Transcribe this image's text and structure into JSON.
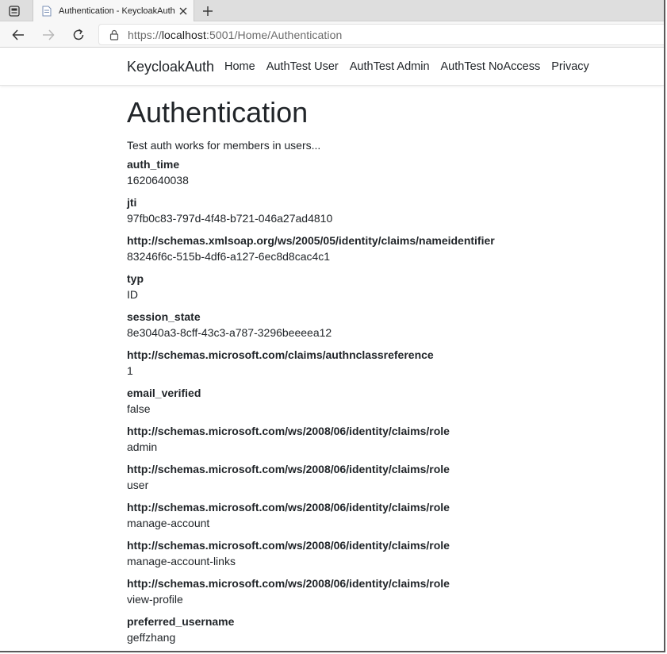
{
  "browser": {
    "tab_title": "Authentication - KeycloakAuth",
    "url_scheme": "https://",
    "url_host": "localhost",
    "url_rest": ":5001/Home/Authentication"
  },
  "site": {
    "brand": "KeycloakAuth",
    "nav": [
      {
        "label": "Home"
      },
      {
        "label": "AuthTest User"
      },
      {
        "label": "AuthTest Admin"
      },
      {
        "label": "AuthTest NoAccess"
      },
      {
        "label": "Privacy"
      }
    ]
  },
  "page": {
    "title": "Authentication",
    "intro": "Test auth works for members in users...",
    "claims": [
      {
        "type": "auth_time",
        "value": "1620640038"
      },
      {
        "type": "jti",
        "value": "97fb0c83-797d-4f48-b721-046a27ad4810"
      },
      {
        "type": "http://schemas.xmlsoap.org/ws/2005/05/identity/claims/nameidentifier",
        "value": "83246f6c-515b-4df6-a127-6ec8d8cac4c1"
      },
      {
        "type": "typ",
        "value": "ID"
      },
      {
        "type": "session_state",
        "value": "8e3040a3-8cff-43c3-a787-3296beeeea12"
      },
      {
        "type": "http://schemas.microsoft.com/claims/authnclassreference",
        "value": "1"
      },
      {
        "type": "email_verified",
        "value": "false"
      },
      {
        "type": "http://schemas.microsoft.com/ws/2008/06/identity/claims/role",
        "value": "admin"
      },
      {
        "type": "http://schemas.microsoft.com/ws/2008/06/identity/claims/role",
        "value": "user"
      },
      {
        "type": "http://schemas.microsoft.com/ws/2008/06/identity/claims/role",
        "value": "manage-account"
      },
      {
        "type": "http://schemas.microsoft.com/ws/2008/06/identity/claims/role",
        "value": "manage-account-links"
      },
      {
        "type": "http://schemas.microsoft.com/ws/2008/06/identity/claims/role",
        "value": "view-profile"
      },
      {
        "type": "preferred_username",
        "value": "geffzhang"
      }
    ]
  },
  "icons": {
    "tab_actions": "tab-actions-icon",
    "favicon": "page-favicon-icon",
    "close": "close-icon",
    "new_tab": "plus-icon",
    "back": "back-arrow-icon",
    "forward": "forward-arrow-icon",
    "refresh": "refresh-icon",
    "lock": "lock-icon"
  }
}
